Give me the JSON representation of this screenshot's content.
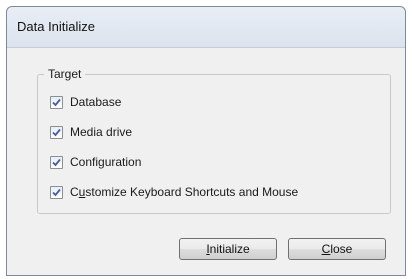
{
  "window": {
    "title": "Data Initialize"
  },
  "target_group": {
    "legend": "Target",
    "options": [
      {
        "label": "Database",
        "checked": true
      },
      {
        "label": "Media drive",
        "checked": true
      },
      {
        "label": "Configuration",
        "checked": true
      },
      {
        "label_prefix": "C",
        "label_mnemonic": "u",
        "label_rest": "stomize Keyboard Shortcuts and Mouse",
        "checked": true
      }
    ]
  },
  "buttons": {
    "initialize_mnemonic": "I",
    "initialize_rest": "nitialize",
    "close_mnemonic": "C",
    "close_rest": "lose"
  },
  "colors": {
    "checkmark": "#4a5f97",
    "dialog_bg": "#f0f0f0"
  }
}
